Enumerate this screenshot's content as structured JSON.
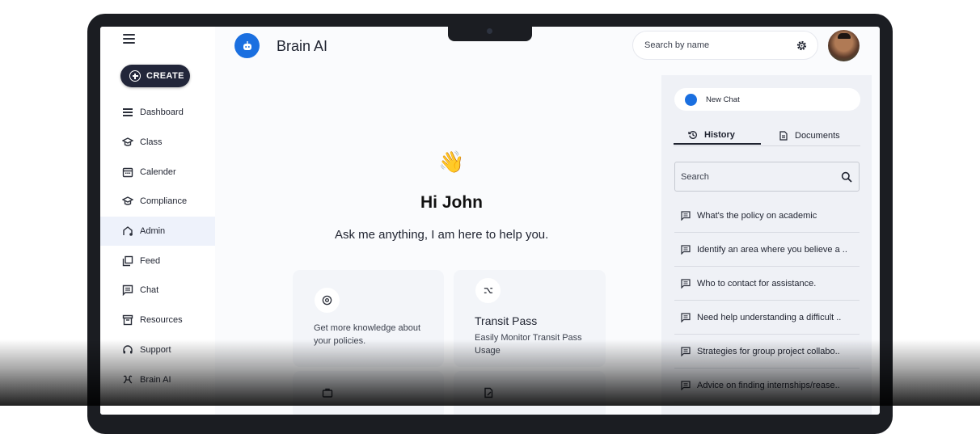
{
  "app": {
    "title": "Brain AI"
  },
  "header": {
    "search_placeholder": "Search by name"
  },
  "sidebar": {
    "create_label": "CREATE",
    "items": [
      {
        "label": "Dashboard",
        "icon": "dashboard-icon"
      },
      {
        "label": "Class",
        "icon": "graduation-cap-icon"
      },
      {
        "label": "Calender",
        "icon": "calendar-icon"
      },
      {
        "label": "Compliance",
        "icon": "graduation-cap-icon"
      },
      {
        "label": "Admin",
        "icon": "admin-icon",
        "active": true
      },
      {
        "label": "Feed",
        "icon": "feed-icon"
      },
      {
        "label": "Chat",
        "icon": "chat-icon"
      },
      {
        "label": "Resources",
        "icon": "archive-icon"
      },
      {
        "label": "Support",
        "icon": "headset-icon"
      },
      {
        "label": "Brain AI",
        "icon": "brain-icon"
      }
    ]
  },
  "main": {
    "wave_emoji": "👋",
    "greeting": "Hi John",
    "subtitle": "Ask me anything, I am here to help you.",
    "cards": [
      {
        "icon": "at-icon",
        "title": "",
        "text": "Get more knowledge about your policies."
      },
      {
        "icon": "route-icon",
        "title": "Transit Pass",
        "text": "Easily Monitor Transit Pass Usage"
      }
    ]
  },
  "right_panel": {
    "new_chat_label": "New Chat",
    "tabs": [
      {
        "label": "History",
        "active": true
      },
      {
        "label": "Documents",
        "active": false
      }
    ],
    "search_placeholder": "Search",
    "history": [
      "What's the policy on academic",
      "Identify an area where you believe a ..",
      "Who to contact for assistance.",
      "Need help understanding a difficult ..",
      "Strategies for group project collabo..",
      "Advice on finding internships/rease.."
    ]
  },
  "colors": {
    "accent": "#1a6fe0",
    "create_button": "#22263a",
    "active_nav": "#eef2fb"
  }
}
